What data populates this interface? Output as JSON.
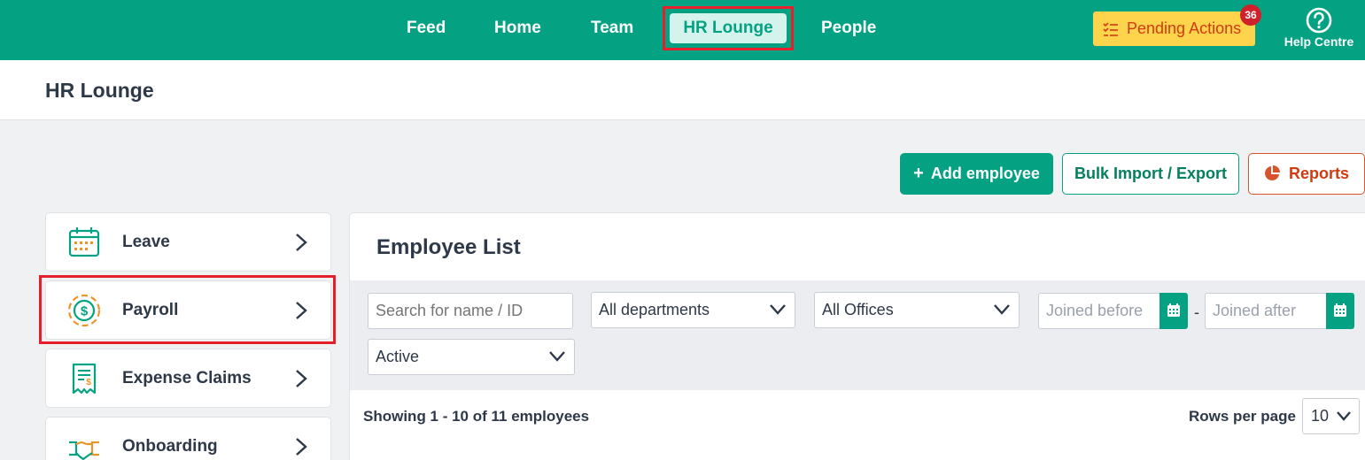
{
  "nav": {
    "items": [
      "Feed",
      "Home",
      "Team",
      "HR Lounge",
      "People"
    ],
    "active": "HR Lounge",
    "pending_actions": "Pending Actions",
    "pending_count": "36",
    "help": "Help Centre"
  },
  "page_title": "HR Lounge",
  "actions": {
    "add_employee": "Add employee",
    "bulk": "Bulk Import / Export",
    "reports": "Reports"
  },
  "side_menu": {
    "items": [
      {
        "label": "Leave",
        "icon": "calendar-icon"
      },
      {
        "label": "Payroll",
        "icon": "dollar-coin-icon"
      },
      {
        "label": "Expense Claims",
        "icon": "receipt-icon"
      },
      {
        "label": "Onboarding",
        "icon": "handshake-icon"
      }
    ]
  },
  "employee_list": {
    "title": "Employee List",
    "filters": {
      "search_placeholder": "Search for name / ID",
      "department": "All departments",
      "office": "All Offices",
      "joined_before_placeholder": "Joined before",
      "joined_after_placeholder": "Joined after",
      "date_separator": "-",
      "status": "Active"
    },
    "showing": "Showing 1 - 10 of 11 employees",
    "rows_per_page_label": "Rows per page",
    "rows_per_page": "10"
  },
  "colors": {
    "brand": "#04a283",
    "highlight": "#e3202b",
    "pending_bg": "#ffd44d",
    "reports": "#d03b10"
  }
}
